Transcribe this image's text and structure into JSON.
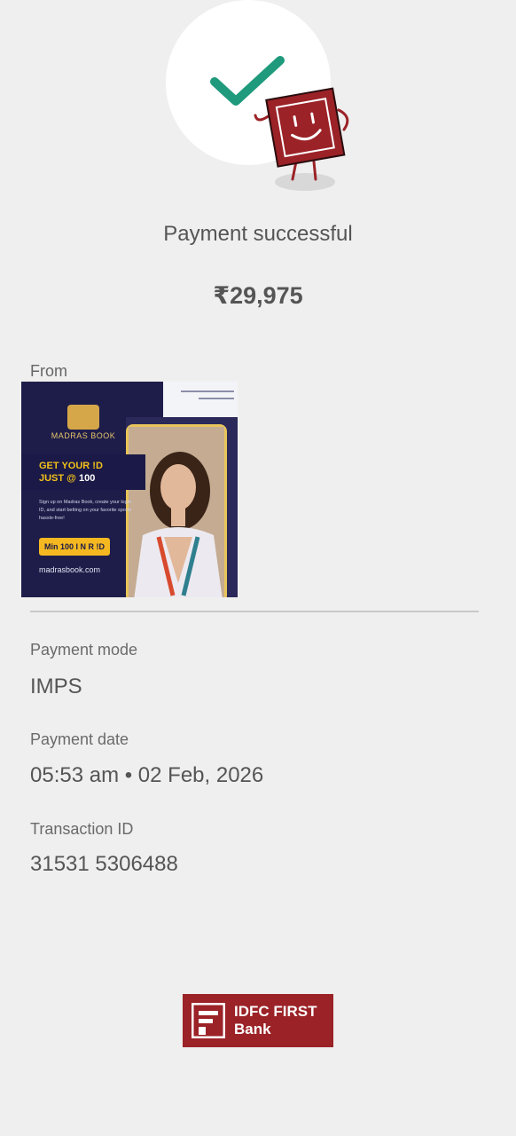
{
  "header": {
    "status_text": "Payment successful",
    "amount": "₹29,975",
    "success_icon": "check-icon",
    "mascot": "smiling-box-mascot",
    "accent_color": "#1f9a7c",
    "mascot_color": "#9b2227"
  },
  "from": {
    "label": "From",
    "ad": {
      "brand": "MADRAS BOOK",
      "headline_line1": "GET YOUR !D",
      "headline_line2_prefix": "JUST @ ",
      "headline_line2_value": "100",
      "subtext": "Sign up on Madras Book, create your login ID, and start betting on your favorite sports hassle-free!",
      "cta": "Min 100 I N R !D",
      "website": "madrasbook.com"
    }
  },
  "details": [
    {
      "label": "Payment mode",
      "value": "IMPS"
    },
    {
      "label": "Payment date",
      "value": "05:53 am • 02 Feb, 2026"
    },
    {
      "label": "Transaction ID",
      "value": "31531 5306488"
    }
  ],
  "footer": {
    "bank_name_line1": "IDFC FIRST",
    "bank_name_line2": "Bank",
    "bank_color": "#9b2227"
  }
}
